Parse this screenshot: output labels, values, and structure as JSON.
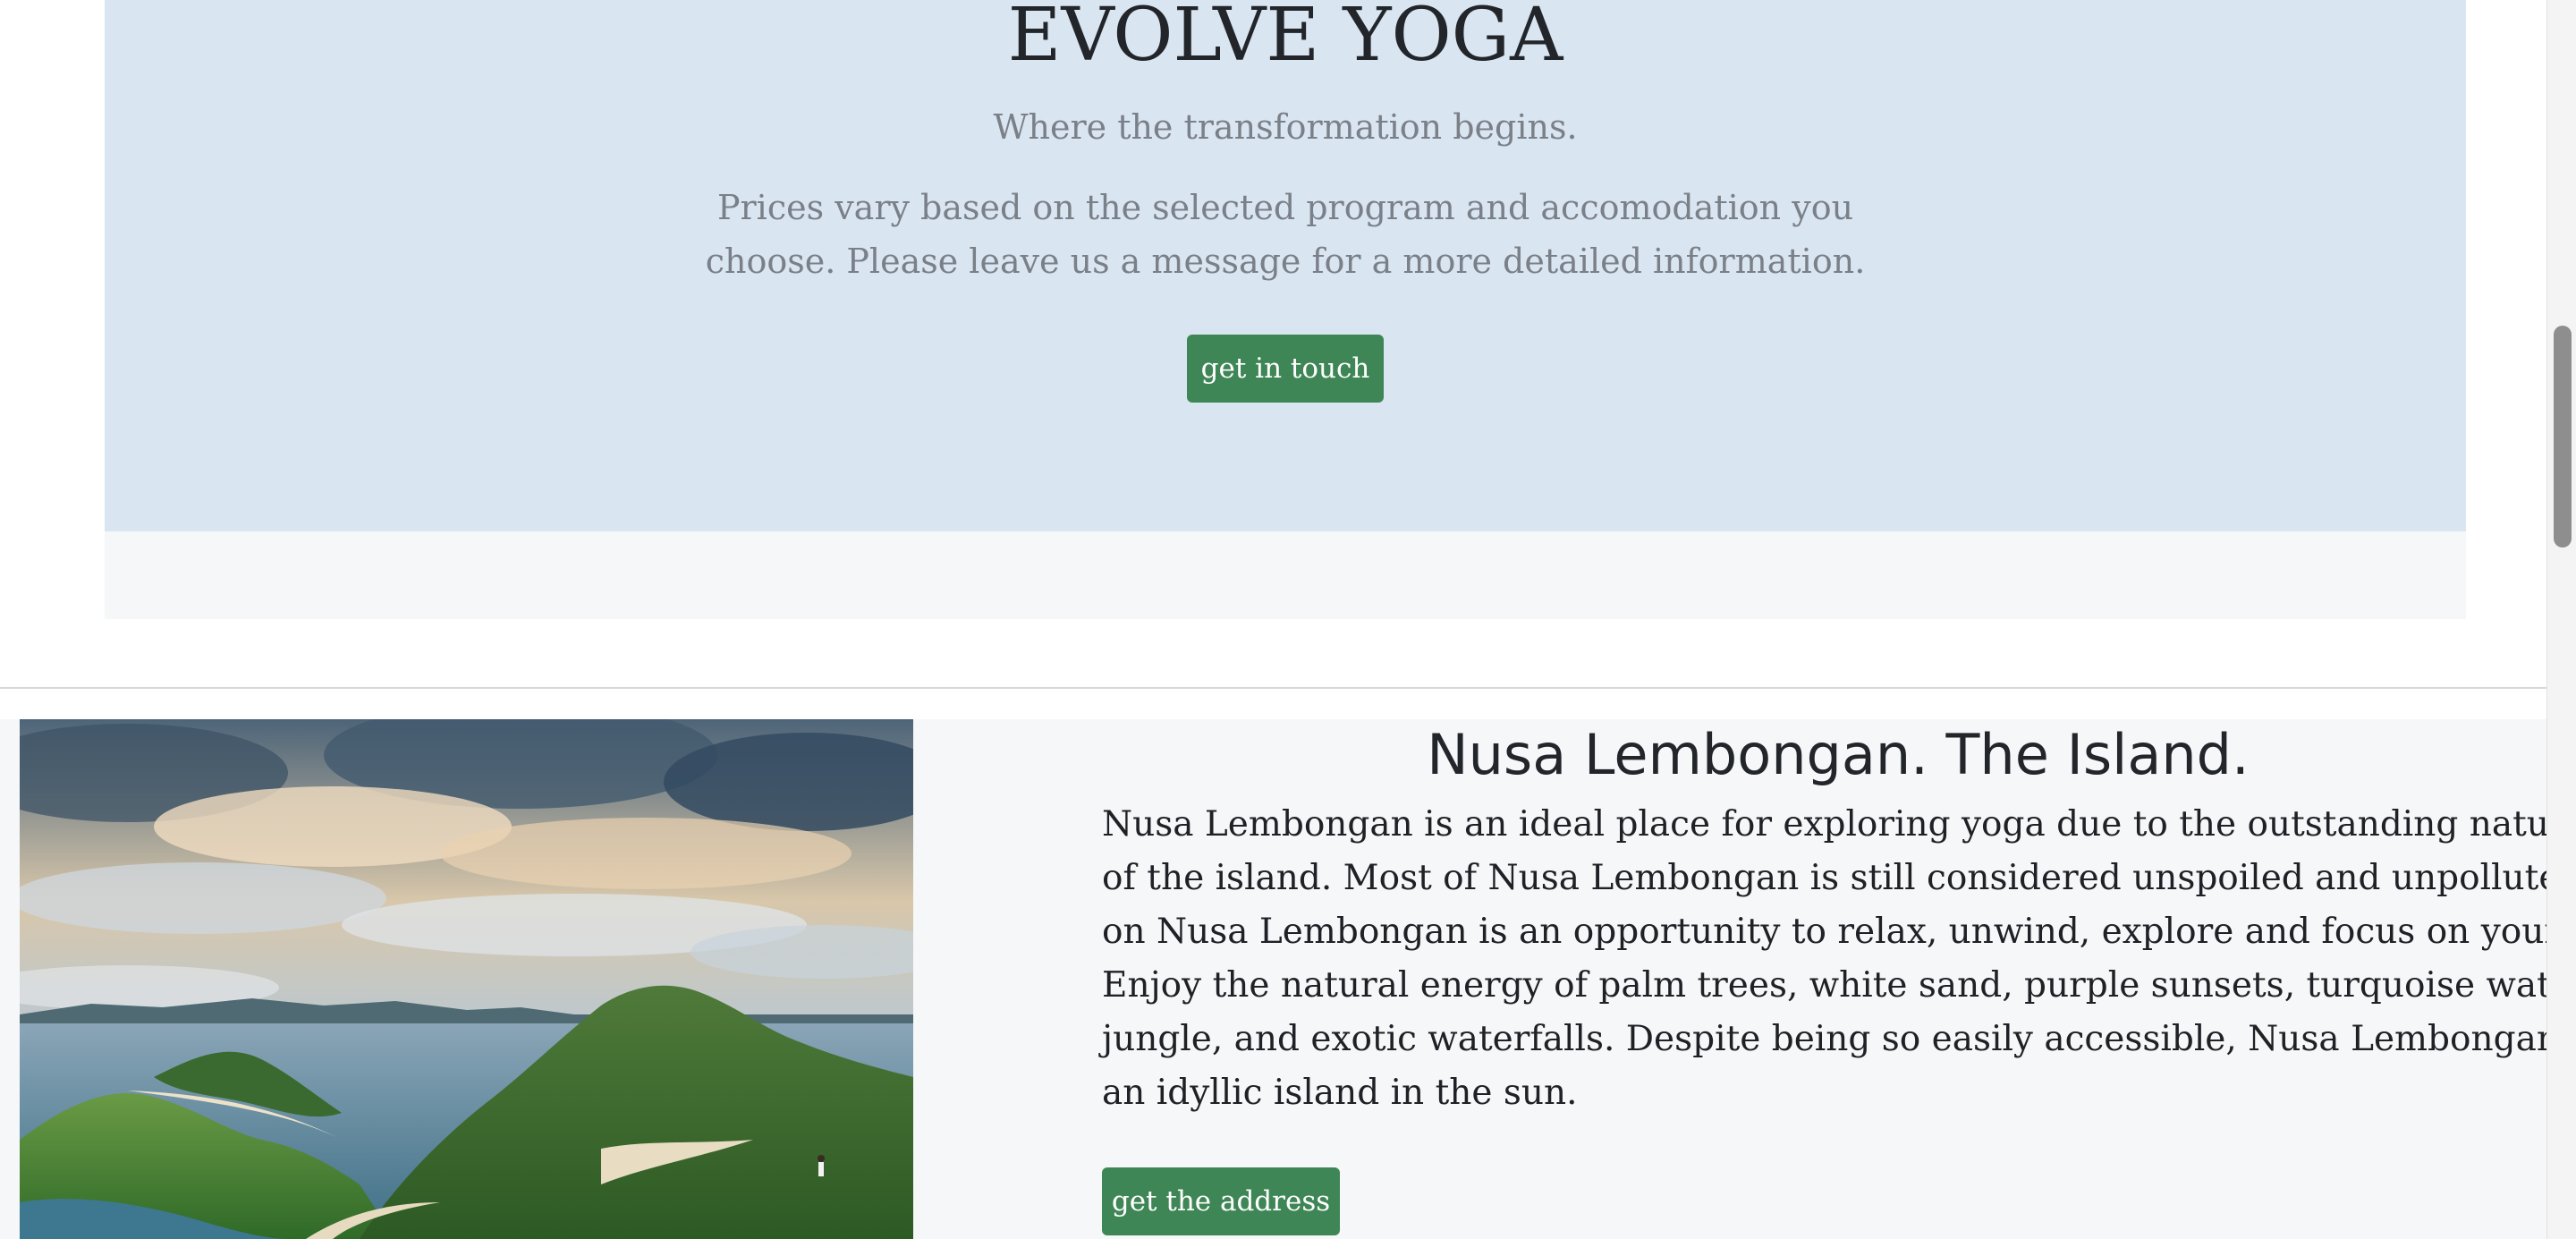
{
  "hero": {
    "title": "EVOLVE YOGA",
    "subtitle": "Where the transformation begins.",
    "description": "Prices vary based on the selected program and accomodation you choose. Please leave us a message for a more detailed information.",
    "button_label": "get in touch"
  },
  "island": {
    "title": "Nusa Lembongan. The Island.",
    "paragraph_lines": [
      "Nusa Lembongan is an ideal place for exploring yoga due to the outstanding natural beauty",
      "of the island. Most of Nusa Lembongan is still considered unspoiled and unpolluted. Time",
      "on Nusa Lembongan is an opportunity to relax, unwind, explore and focus on yourself.",
      "Enjoy the natural energy of palm trees, white sand, purple sunsets, turquoise waters, dense",
      "jungle, and exotic waterfalls. Despite being so easily accessible, Nusa Lembongan remains",
      "an idyllic island in the sun."
    ],
    "button_label": "get the address"
  },
  "colors": {
    "hero_bg": "#dae5f2",
    "section_bg": "#f6f7f9",
    "button_bg": "#3f8656",
    "title_text": "#22262b",
    "muted_text": "#7a8088"
  }
}
